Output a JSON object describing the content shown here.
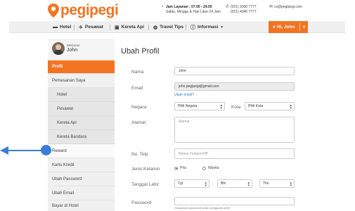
{
  "brand": {
    "name": "pegipegi",
    "color": "#f27422"
  },
  "header": {
    "hours_title": "Jam Layanan : 07.00 - 24.00",
    "hours_sub": "Sabtu, Minggu & Hari Libur 24 Jam",
    "phone1": "(021) 3000 7777",
    "phone2": "(021) 4040 7777",
    "email": "cs@pegipegi.com"
  },
  "nav": {
    "items": [
      {
        "label": "Hotel",
        "icon": "bed-icon"
      },
      {
        "label": "Pesawat",
        "icon": "plane-icon"
      },
      {
        "label": "Kereta Api",
        "icon": "train-icon"
      },
      {
        "label": "Travel Tips",
        "icon": "globe-icon"
      },
      {
        "label": "Informasi",
        "icon": "info-icon"
      }
    ],
    "user_button": "Hi, John"
  },
  "sidebar": {
    "welcome_label": "Welcome",
    "welcome_name": "John",
    "items": [
      {
        "label": "Profil",
        "active": true
      },
      {
        "label": "Pemesanan Saya"
      },
      {
        "label": "Hotel",
        "sub": true
      },
      {
        "label": "Pesawat",
        "sub": true
      },
      {
        "label": "Kereta Api",
        "sub": true
      },
      {
        "label": "Kereta Bandara",
        "sub": true
      },
      {
        "label": "Reward"
      },
      {
        "label": "Kartu Kredit"
      },
      {
        "label": "Ubah Password"
      },
      {
        "label": "Ubah Email"
      },
      {
        "label": "Bayar di Hotel"
      }
    ]
  },
  "form": {
    "title": "Ubah Profil",
    "nama_label": "Nama",
    "nama_value": "John",
    "email_label": "Email",
    "email_value": "john.pegipegi@gmail.com",
    "email_link": "Ubah email?",
    "negara_label": "Negara",
    "negara_value": "Pilih Negara",
    "kota_label": "Kota",
    "kota_value": "Pilih Kota",
    "alamat_label": "Alamat",
    "alamat_placeholder": "Alamat",
    "telp_label": "No. Telp",
    "telp_placeholder": "Nomor Telepon/HP",
    "gender_label": "Jenis Kelamin",
    "gender_male": "Pria",
    "gender_female": "Wanita",
    "dob_label": "Tanggal Lahir",
    "dob_day": "Tgl",
    "dob_month": "Bln",
    "dob_year": "Thn",
    "password_label": "Password",
    "password_hint": "*masukkan password untuk mengubah profil"
  },
  "colors": {
    "accent": "#f27422",
    "annotation": "#3b7dd8"
  }
}
